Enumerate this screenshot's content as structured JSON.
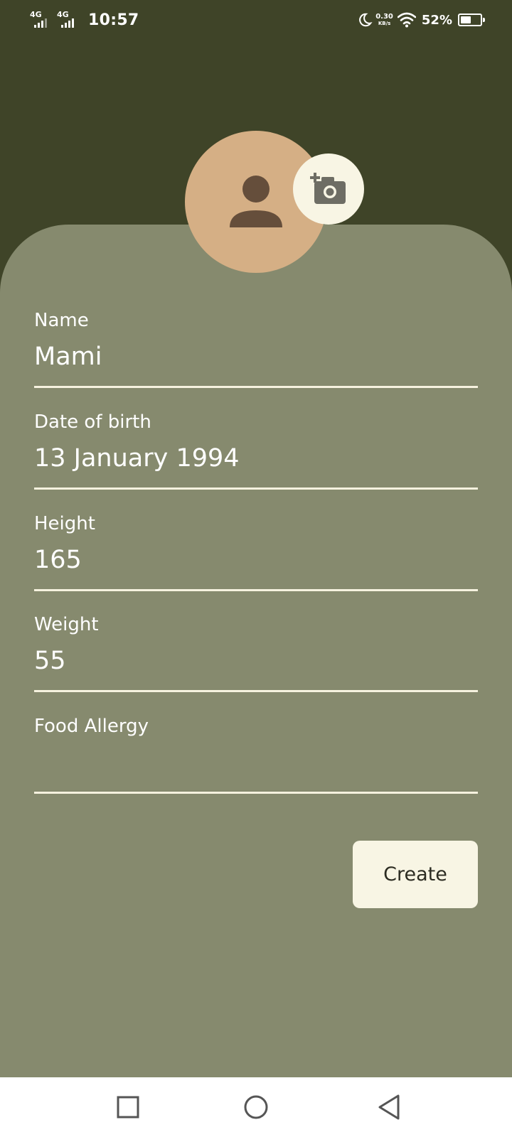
{
  "status_bar": {
    "network_1": "4G",
    "network_2": "4G",
    "time": "10:57",
    "speed_value": "0.30",
    "speed_unit": "KB/s",
    "battery_percent": "52%",
    "battery_level": 0.52
  },
  "profile": {
    "avatar_icon": "person-icon",
    "add_photo_icon": "add-camera-icon"
  },
  "form": {
    "name_label": "Name",
    "name_value": "Mami",
    "dob_label": "Date of birth",
    "dob_value": "13 January 1994",
    "height_label": "Height",
    "height_value": "165",
    "weight_label": "Weight",
    "weight_value": "55",
    "allergy_label": "Food Allergy",
    "allergy_value": ""
  },
  "actions": {
    "create_label": "Create"
  },
  "colors": {
    "header_bg": "#3f4428",
    "card_bg": "#868a6e",
    "avatar_bg": "#d5af85",
    "button_bg": "#f8f5e4",
    "underline": "#f6f2df"
  },
  "navigation": {
    "recents_icon": "square-icon",
    "home_icon": "circle-icon",
    "back_icon": "triangle-back-icon"
  }
}
